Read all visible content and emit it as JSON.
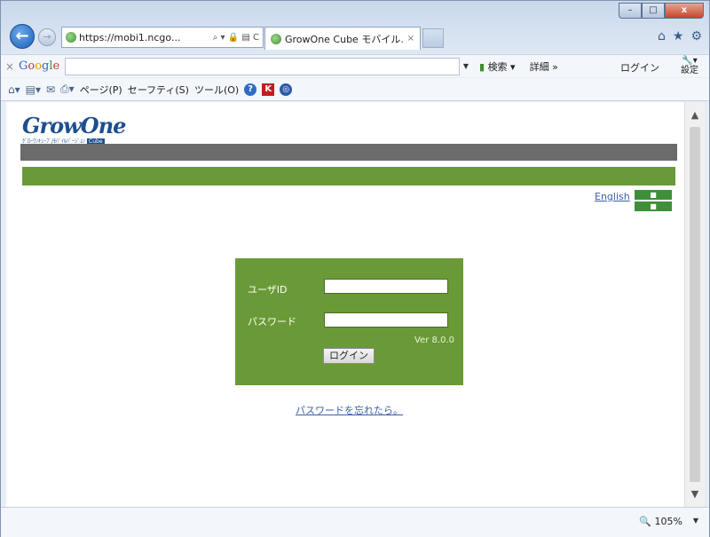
{
  "browser": {
    "address": "https://mobi1.ncgo...",
    "address_icons": "⌕ ▾ 🔒 ▤ C",
    "tab_title": "GrowOne Cube モバイル...",
    "tab_close": "×",
    "window_controls": {
      "min": "–",
      "max": "□",
      "close": "x"
    },
    "nav_back": "←",
    "nav_forward": "→",
    "right_icons": {
      "home": "⌂",
      "favorites": "★",
      "tools": "⚙"
    }
  },
  "google_toolbar": {
    "close": "×",
    "logo": {
      "g1": "G",
      "o1": "o",
      "o2": "o",
      "g2": "g",
      "l": "l",
      "e": "e"
    },
    "search_label": "検索",
    "more_label": "詳細 »",
    "login_label": "ログイン",
    "settings_label": "設定"
  },
  "command_bar": {
    "page_label": "ページ(P)",
    "safety_label": "セーフティ(S)",
    "tools_label": "ツール(O)"
  },
  "page": {
    "logo_text": "GrowOne",
    "logo_sub": "ｸﾞﾛｰﾜﾝｷｭｰﾌﾞ/ﾓﾊﾞｲﾙﾊﾞｰｼﾞｮﾝ",
    "logo_cube": "Cube",
    "english_link": "English",
    "lang_btn_1": "■",
    "lang_btn_2": "■",
    "login": {
      "user_id_label": "ユーザID",
      "password_label": "パスワード",
      "version": "Ver 8.0.0",
      "login_button": "ログイン"
    },
    "forgot_password": "パスワードを忘れたら。"
  },
  "scrollbar": {
    "up": "▲",
    "down": "▼"
  },
  "status_bar": {
    "zoom": "105%",
    "zoom_drop": "▼"
  }
}
